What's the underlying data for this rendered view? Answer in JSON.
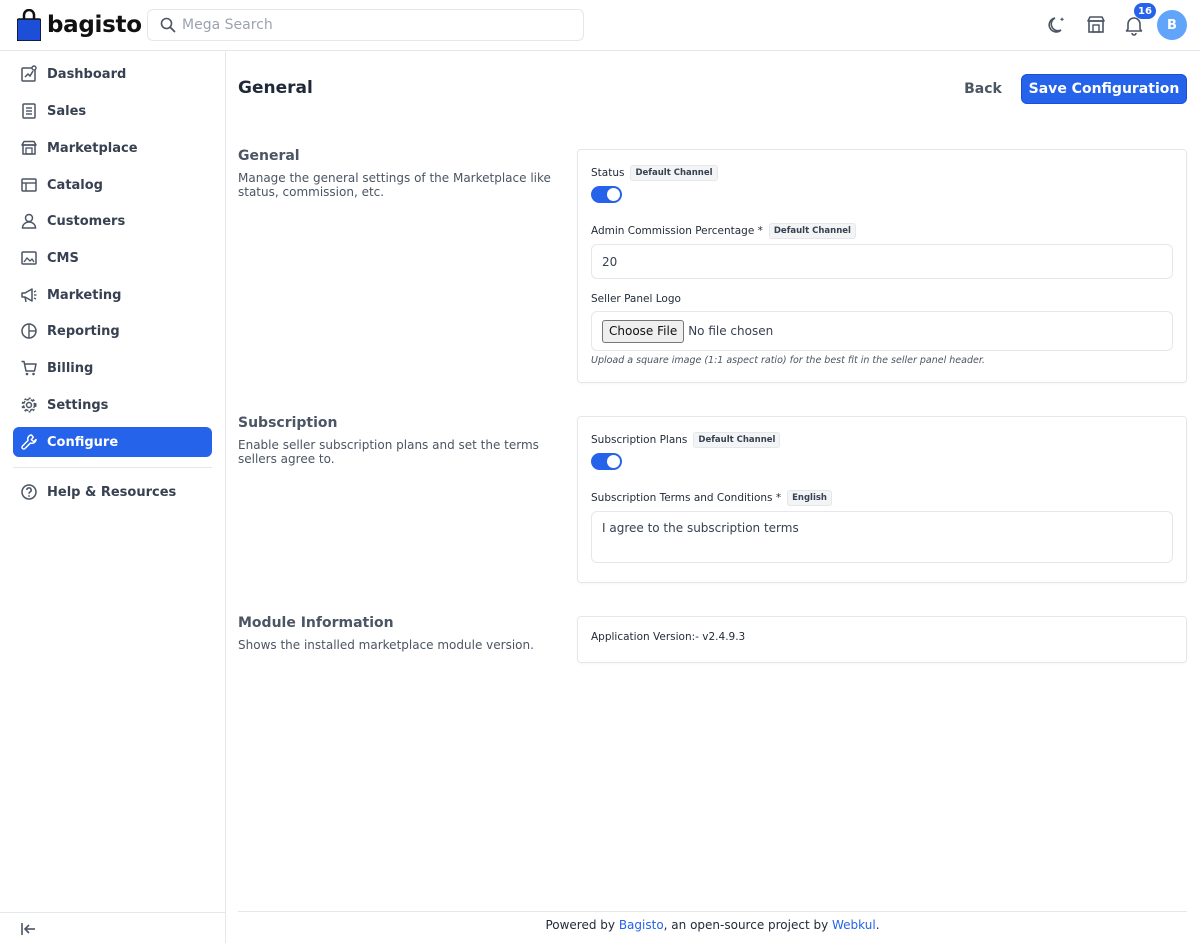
{
  "brand": {
    "name": "bagisto",
    "accent": "#2563eb"
  },
  "header": {
    "search_placeholder": "Mega Search",
    "notification_count": "16",
    "avatar_initial": "B"
  },
  "sidebar": {
    "items": [
      {
        "label": "Dashboard",
        "icon": "dashboard-icon"
      },
      {
        "label": "Sales",
        "icon": "sales-icon"
      },
      {
        "label": "Marketplace",
        "icon": "store-icon"
      },
      {
        "label": "Catalog",
        "icon": "catalog-icon"
      },
      {
        "label": "Customers",
        "icon": "user-icon"
      },
      {
        "label": "CMS",
        "icon": "cms-icon"
      },
      {
        "label": "Marketing",
        "icon": "megaphone-icon"
      },
      {
        "label": "Reporting",
        "icon": "pie-chart-icon"
      },
      {
        "label": "Billing",
        "icon": "cart-icon"
      },
      {
        "label": "Settings",
        "icon": "gear-icon"
      },
      {
        "label": "Configure",
        "icon": "wrench-icon",
        "active": true
      }
    ],
    "help": {
      "label": "Help & Resources",
      "icon": "help-icon"
    }
  },
  "main": {
    "title": "General",
    "back_label": "Back",
    "save_label": "Save Configuration",
    "sections": {
      "general": {
        "title": "General",
        "description": "Manage the general settings of the Marketplace like status, commission, etc.",
        "status_label": "Status",
        "status_scope": "Default Channel",
        "status_enabled": true,
        "commission_label": "Admin Commission Percentage *",
        "commission_scope": "Default Channel",
        "commission_value": "20",
        "logo_label": "Seller Panel Logo",
        "choose_file_label": "Choose File",
        "no_file_label": "No file chosen",
        "logo_hint": "Upload a square image (1:1 aspect ratio) for the best fit in the seller panel header."
      },
      "subscription": {
        "title": "Subscription",
        "description": "Enable seller subscription plans and set the terms sellers agree to.",
        "plans_label": "Subscription Plans",
        "plans_scope": "Default Channel",
        "plans_enabled": true,
        "terms_label": "Subscription Terms and Conditions *",
        "terms_scope": "English",
        "terms_value": "I agree to the subscription terms"
      },
      "module": {
        "title": "Module Information",
        "description": "Shows the installed marketplace module version.",
        "version_text": "Application Version:- v2.4.9.3"
      }
    }
  },
  "footer": {
    "prefix": "Powered by ",
    "link1": "Bagisto",
    "middle": ", an open-source project by ",
    "link2": "Webkul",
    "suffix": "."
  }
}
